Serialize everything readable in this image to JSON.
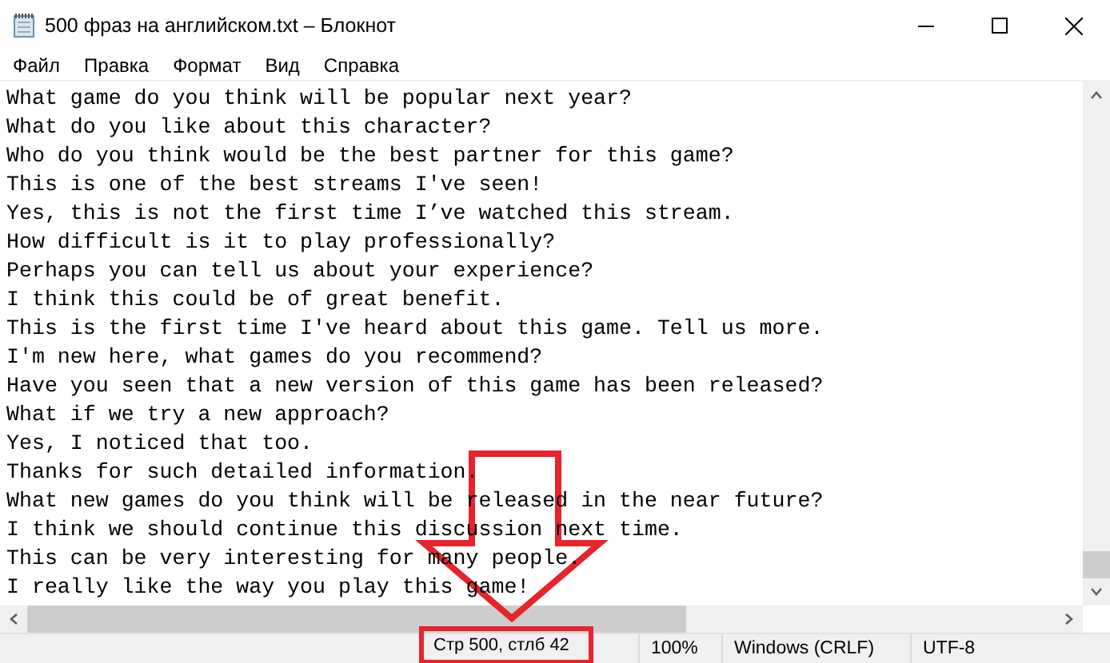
{
  "window": {
    "title": "500 фраз на английском.txt – Блокнот"
  },
  "menu": [
    "Файл",
    "Правка",
    "Формат",
    "Вид",
    "Справка"
  ],
  "lines": [
    "What game do you think will be popular next year?",
    "What do you like about this character?",
    "Who do you think would be the best partner for this game?",
    "This is one of the best streams I've seen!",
    "Yes, this is not the first time I’ve watched this stream.",
    "How difficult is it to play professionally?",
    "Perhaps you can tell us about your experience?",
    "I think this could be of great benefit.",
    "This is the first time I've heard about this game. Tell us more.",
    "I'm new here, what games do you recommend?",
    "Have you seen that a new version of this game has been released?",
    "What if we try a new approach?",
    "Yes, I noticed that too.",
    "Thanks for such detailed information.",
    "What new games do you think will be released in the near future?",
    "I think we should continue this discussion next time.",
    "This can be very interesting for many people.",
    "I really like the way you play this game!"
  ],
  "status_bar": [
    "Стр 500, стлб 42",
    "100%",
    "Windows (CRLF)",
    "UTF-8"
  ]
}
